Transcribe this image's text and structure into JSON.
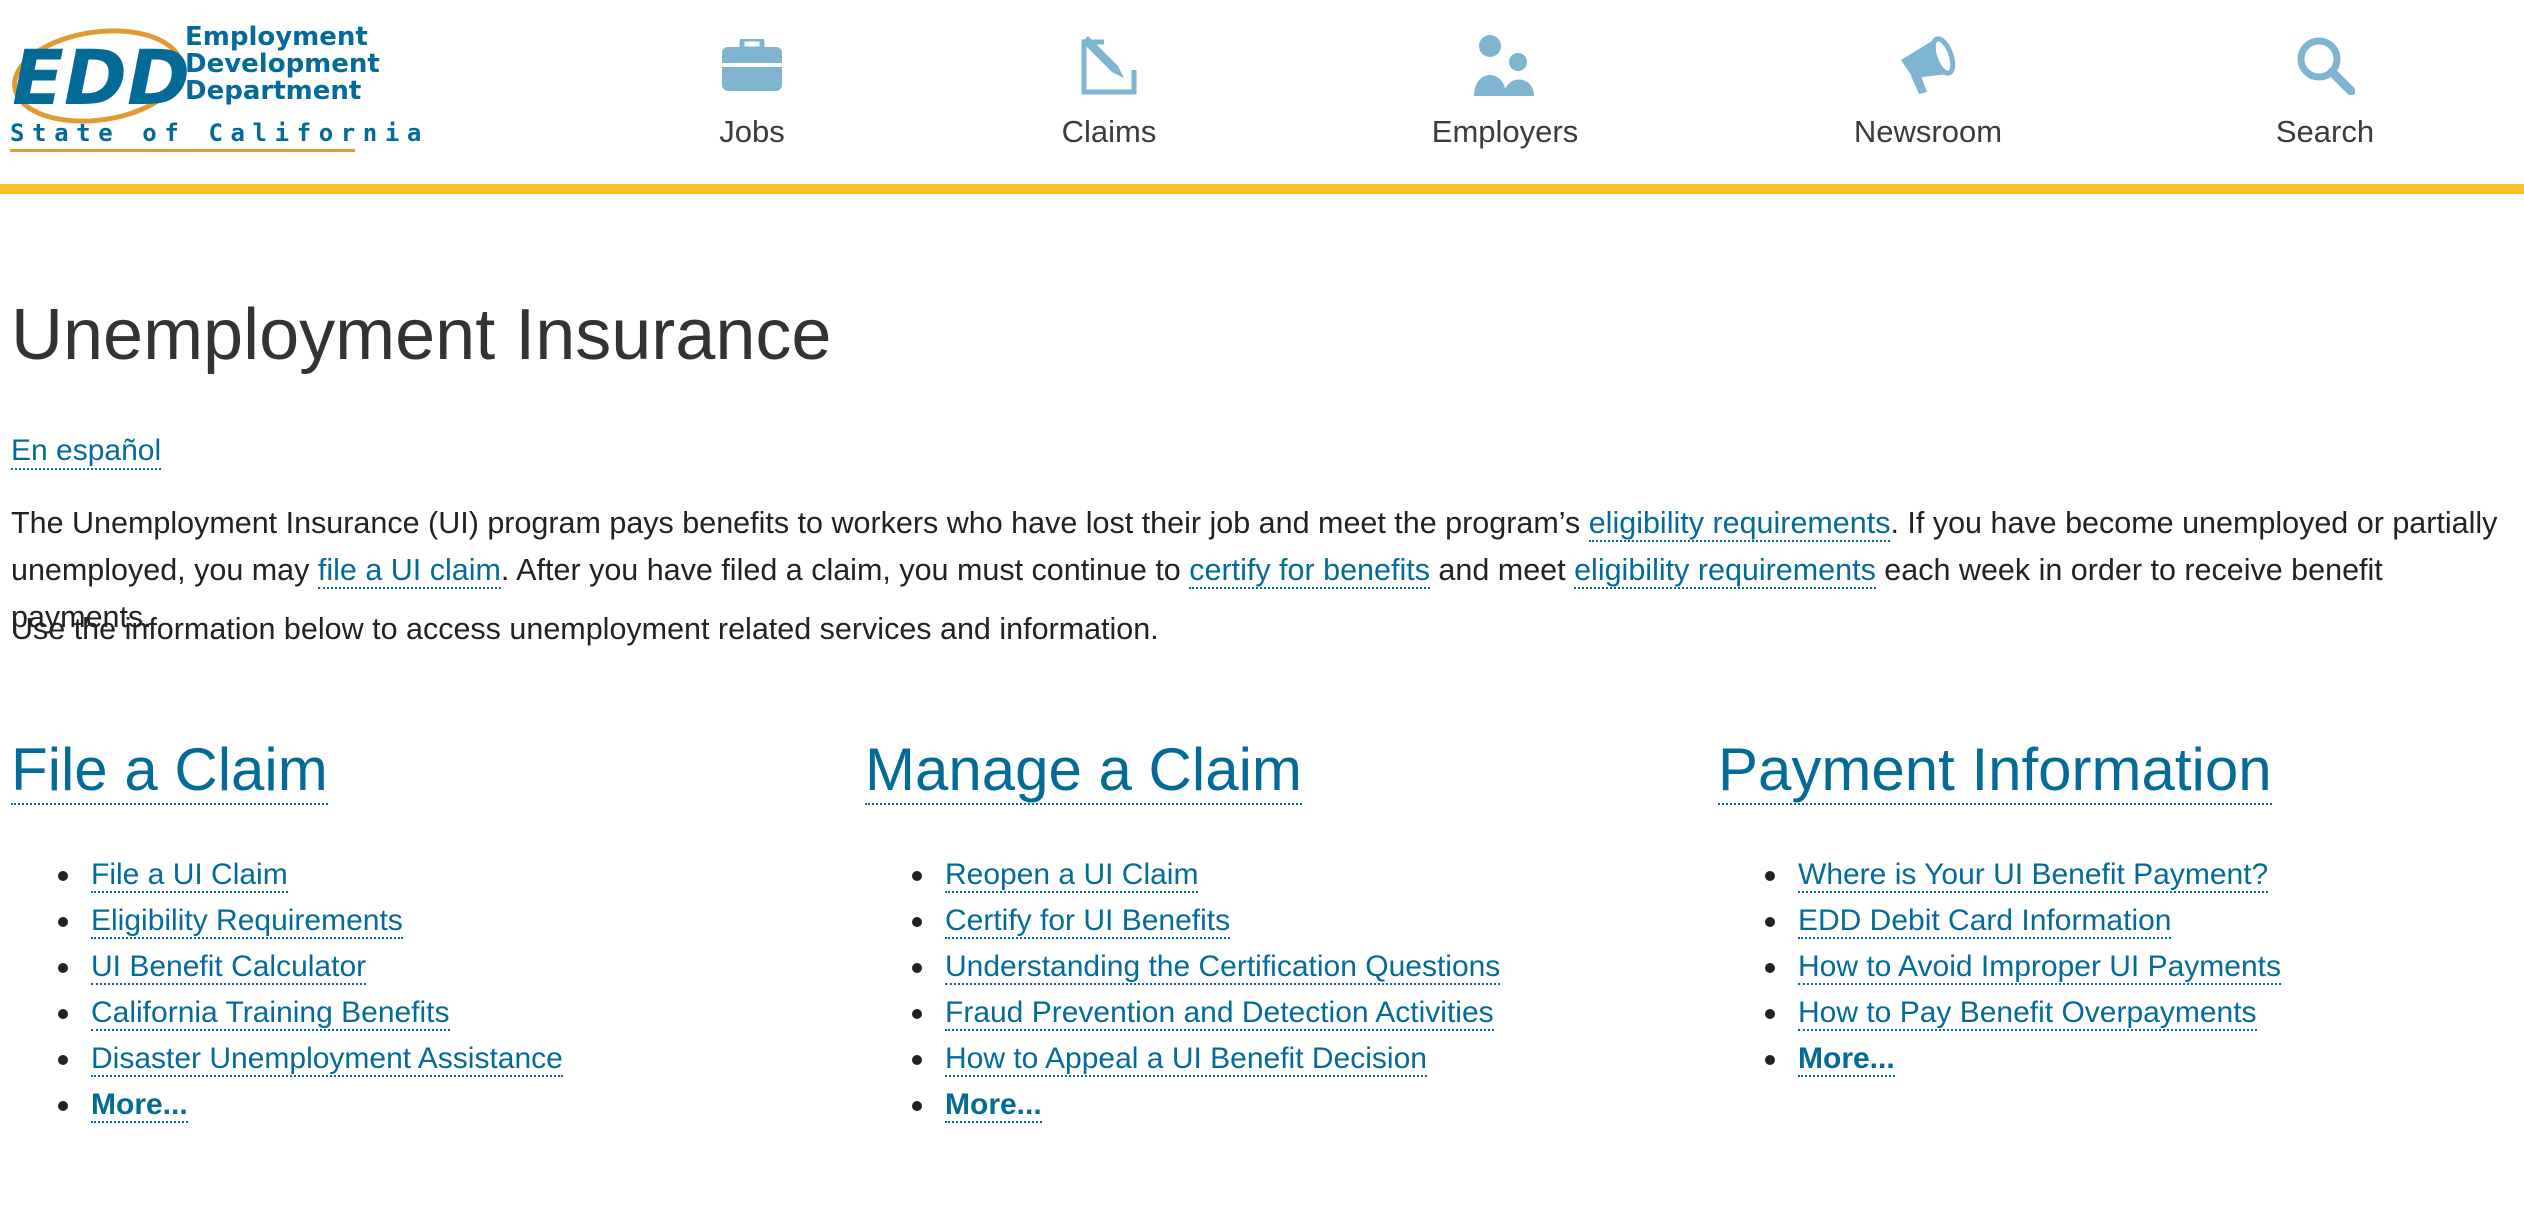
{
  "header": {
    "logo": {
      "abbr": "EDD",
      "line1": "Employment",
      "line2": "Development",
      "line3": "Department",
      "tagline": "State of California"
    },
    "nav": [
      {
        "label": "Jobs",
        "icon": "briefcase-icon"
      },
      {
        "label": "Claims",
        "icon": "edit-icon"
      },
      {
        "label": "Employers",
        "icon": "people-icon"
      },
      {
        "label": "Newsroom",
        "icon": "megaphone-icon"
      },
      {
        "label": "Search",
        "icon": "search-icon"
      }
    ]
  },
  "colors": {
    "brand_blue": "#046b99",
    "accent_gold": "#fbbf2c",
    "icon_light_blue": "#7fb5d0",
    "text_dark": "#222222"
  },
  "main": {
    "title": "Unemployment Insurance",
    "lang_link": "En español",
    "intro": {
      "p1_a": "The Unemployment Insurance (UI) program pays benefits to workers who have lost their job and meet the program’s ",
      "p1_link1": "eligibility requirements",
      "p1_b": ". If you have become unemployed or partially unemployed, you may ",
      "p1_link2": "file a UI claim",
      "p1_c": ". After you have filed a claim, you must continue to ",
      "p1_link3": "certify for benefits",
      "p1_d": " and meet ",
      "p1_link4": "eligibility requirements",
      "p1_e": " each week in order to receive benefit payments.",
      "p2": "Use the information below to access unemployment related services and information."
    },
    "sections": [
      {
        "heading": "File a Claim",
        "links": [
          "File a UI Claim",
          "Eligibility Requirements",
          "UI Benefit Calculator",
          "California Training Benefits",
          "Disaster Unemployment Assistance"
        ],
        "more": "More..."
      },
      {
        "heading": "Manage a Claim",
        "links": [
          "Reopen a UI Claim",
          "Certify for UI Benefits",
          "Understanding the Certification Questions",
          "Fraud Prevention and Detection Activities",
          "How to Appeal a UI Benefit Decision"
        ],
        "more": "More..."
      },
      {
        "heading": "Payment Information",
        "links": [
          "Where is Your UI Benefit Payment?",
          "EDD Debit Card Information",
          "How to Avoid Improper UI Payments",
          "How to Pay Benefit Overpayments"
        ],
        "more": "More..."
      }
    ]
  }
}
